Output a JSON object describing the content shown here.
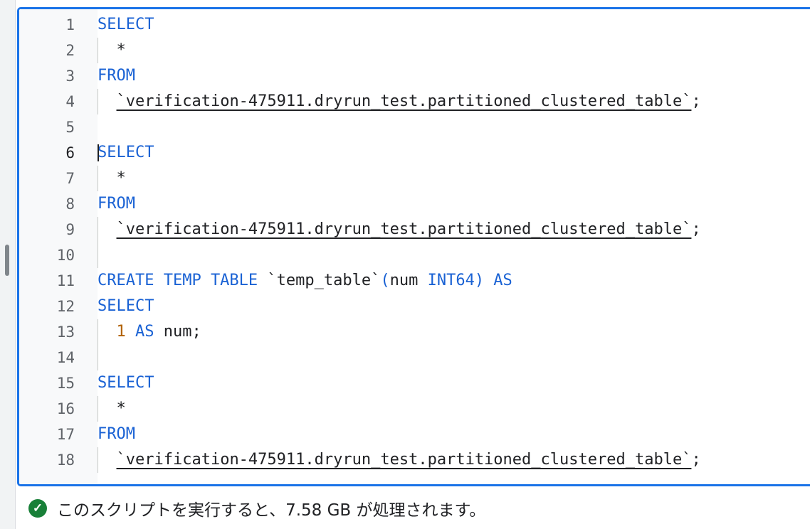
{
  "editor": {
    "active_line": 6,
    "lines": [
      {
        "n": "1",
        "indent": false,
        "tokens": [
          {
            "t": "SELECT",
            "c": "kw"
          }
        ]
      },
      {
        "n": "2",
        "indent": true,
        "tokens": [
          {
            "t": "  *",
            "c": ""
          }
        ]
      },
      {
        "n": "3",
        "indent": false,
        "tokens": [
          {
            "t": "FROM",
            "c": "kw"
          }
        ]
      },
      {
        "n": "4",
        "indent": true,
        "tokens": [
          {
            "t": "  ",
            "c": ""
          },
          {
            "t": "`verification-475911.dryrun_test.partitioned_clustered_table`",
            "c": "tbl"
          },
          {
            "t": ";",
            "c": ""
          }
        ]
      },
      {
        "n": "5",
        "indent": false,
        "tokens": []
      },
      {
        "n": "6",
        "indent": false,
        "tokens": [
          {
            "t": "SELECT",
            "c": "kw"
          }
        ]
      },
      {
        "n": "7",
        "indent": true,
        "tokens": [
          {
            "t": "  *",
            "c": ""
          }
        ]
      },
      {
        "n": "8",
        "indent": false,
        "tokens": [
          {
            "t": "FROM",
            "c": "kw"
          }
        ]
      },
      {
        "n": "9",
        "indent": true,
        "tokens": [
          {
            "t": "  ",
            "c": ""
          },
          {
            "t": "`verification-475911.dryrun_test.partitioned_clustered_table`",
            "c": "tbl"
          },
          {
            "t": ";",
            "c": ""
          }
        ]
      },
      {
        "n": "10",
        "indent": true,
        "tokens": []
      },
      {
        "n": "11",
        "indent": false,
        "tokens": [
          {
            "t": "CREATE TEMP TABLE",
            "c": "kw"
          },
          {
            "t": " `temp_table`",
            "c": ""
          },
          {
            "t": "(",
            "c": "kw"
          },
          {
            "t": "num ",
            "c": ""
          },
          {
            "t": "INT64) AS",
            "c": "kw"
          }
        ]
      },
      {
        "n": "12",
        "indent": false,
        "tokens": [
          {
            "t": "SELECT",
            "c": "kw"
          }
        ]
      },
      {
        "n": "13",
        "indent": true,
        "tokens": [
          {
            "t": "  ",
            "c": ""
          },
          {
            "t": "1",
            "c": "num"
          },
          {
            "t": " ",
            "c": ""
          },
          {
            "t": "AS",
            "c": "kw"
          },
          {
            "t": " num;",
            "c": ""
          }
        ]
      },
      {
        "n": "14",
        "indent": true,
        "tokens": []
      },
      {
        "n": "15",
        "indent": false,
        "tokens": [
          {
            "t": "SELECT",
            "c": "kw"
          }
        ]
      },
      {
        "n": "16",
        "indent": true,
        "tokens": [
          {
            "t": "  *",
            "c": ""
          }
        ]
      },
      {
        "n": "17",
        "indent": false,
        "tokens": [
          {
            "t": "FROM",
            "c": "kw"
          }
        ]
      },
      {
        "n": "18",
        "indent": true,
        "tokens": [
          {
            "t": "  ",
            "c": ""
          },
          {
            "t": "`verification-475911.dryrun_test.partitioned_clustered_table`",
            "c": "tbl"
          },
          {
            "t": ";",
            "c": ""
          }
        ]
      }
    ]
  },
  "status": {
    "icon": "check-circle-icon",
    "icon_glyph": "✓",
    "message": "このスクリプトを実行すると、7.58 GB が処理されます。",
    "color": "#188038"
  },
  "colors": {
    "accent": "#1a73e8",
    "keyword": "#1a62d4",
    "number": "#b06000"
  }
}
